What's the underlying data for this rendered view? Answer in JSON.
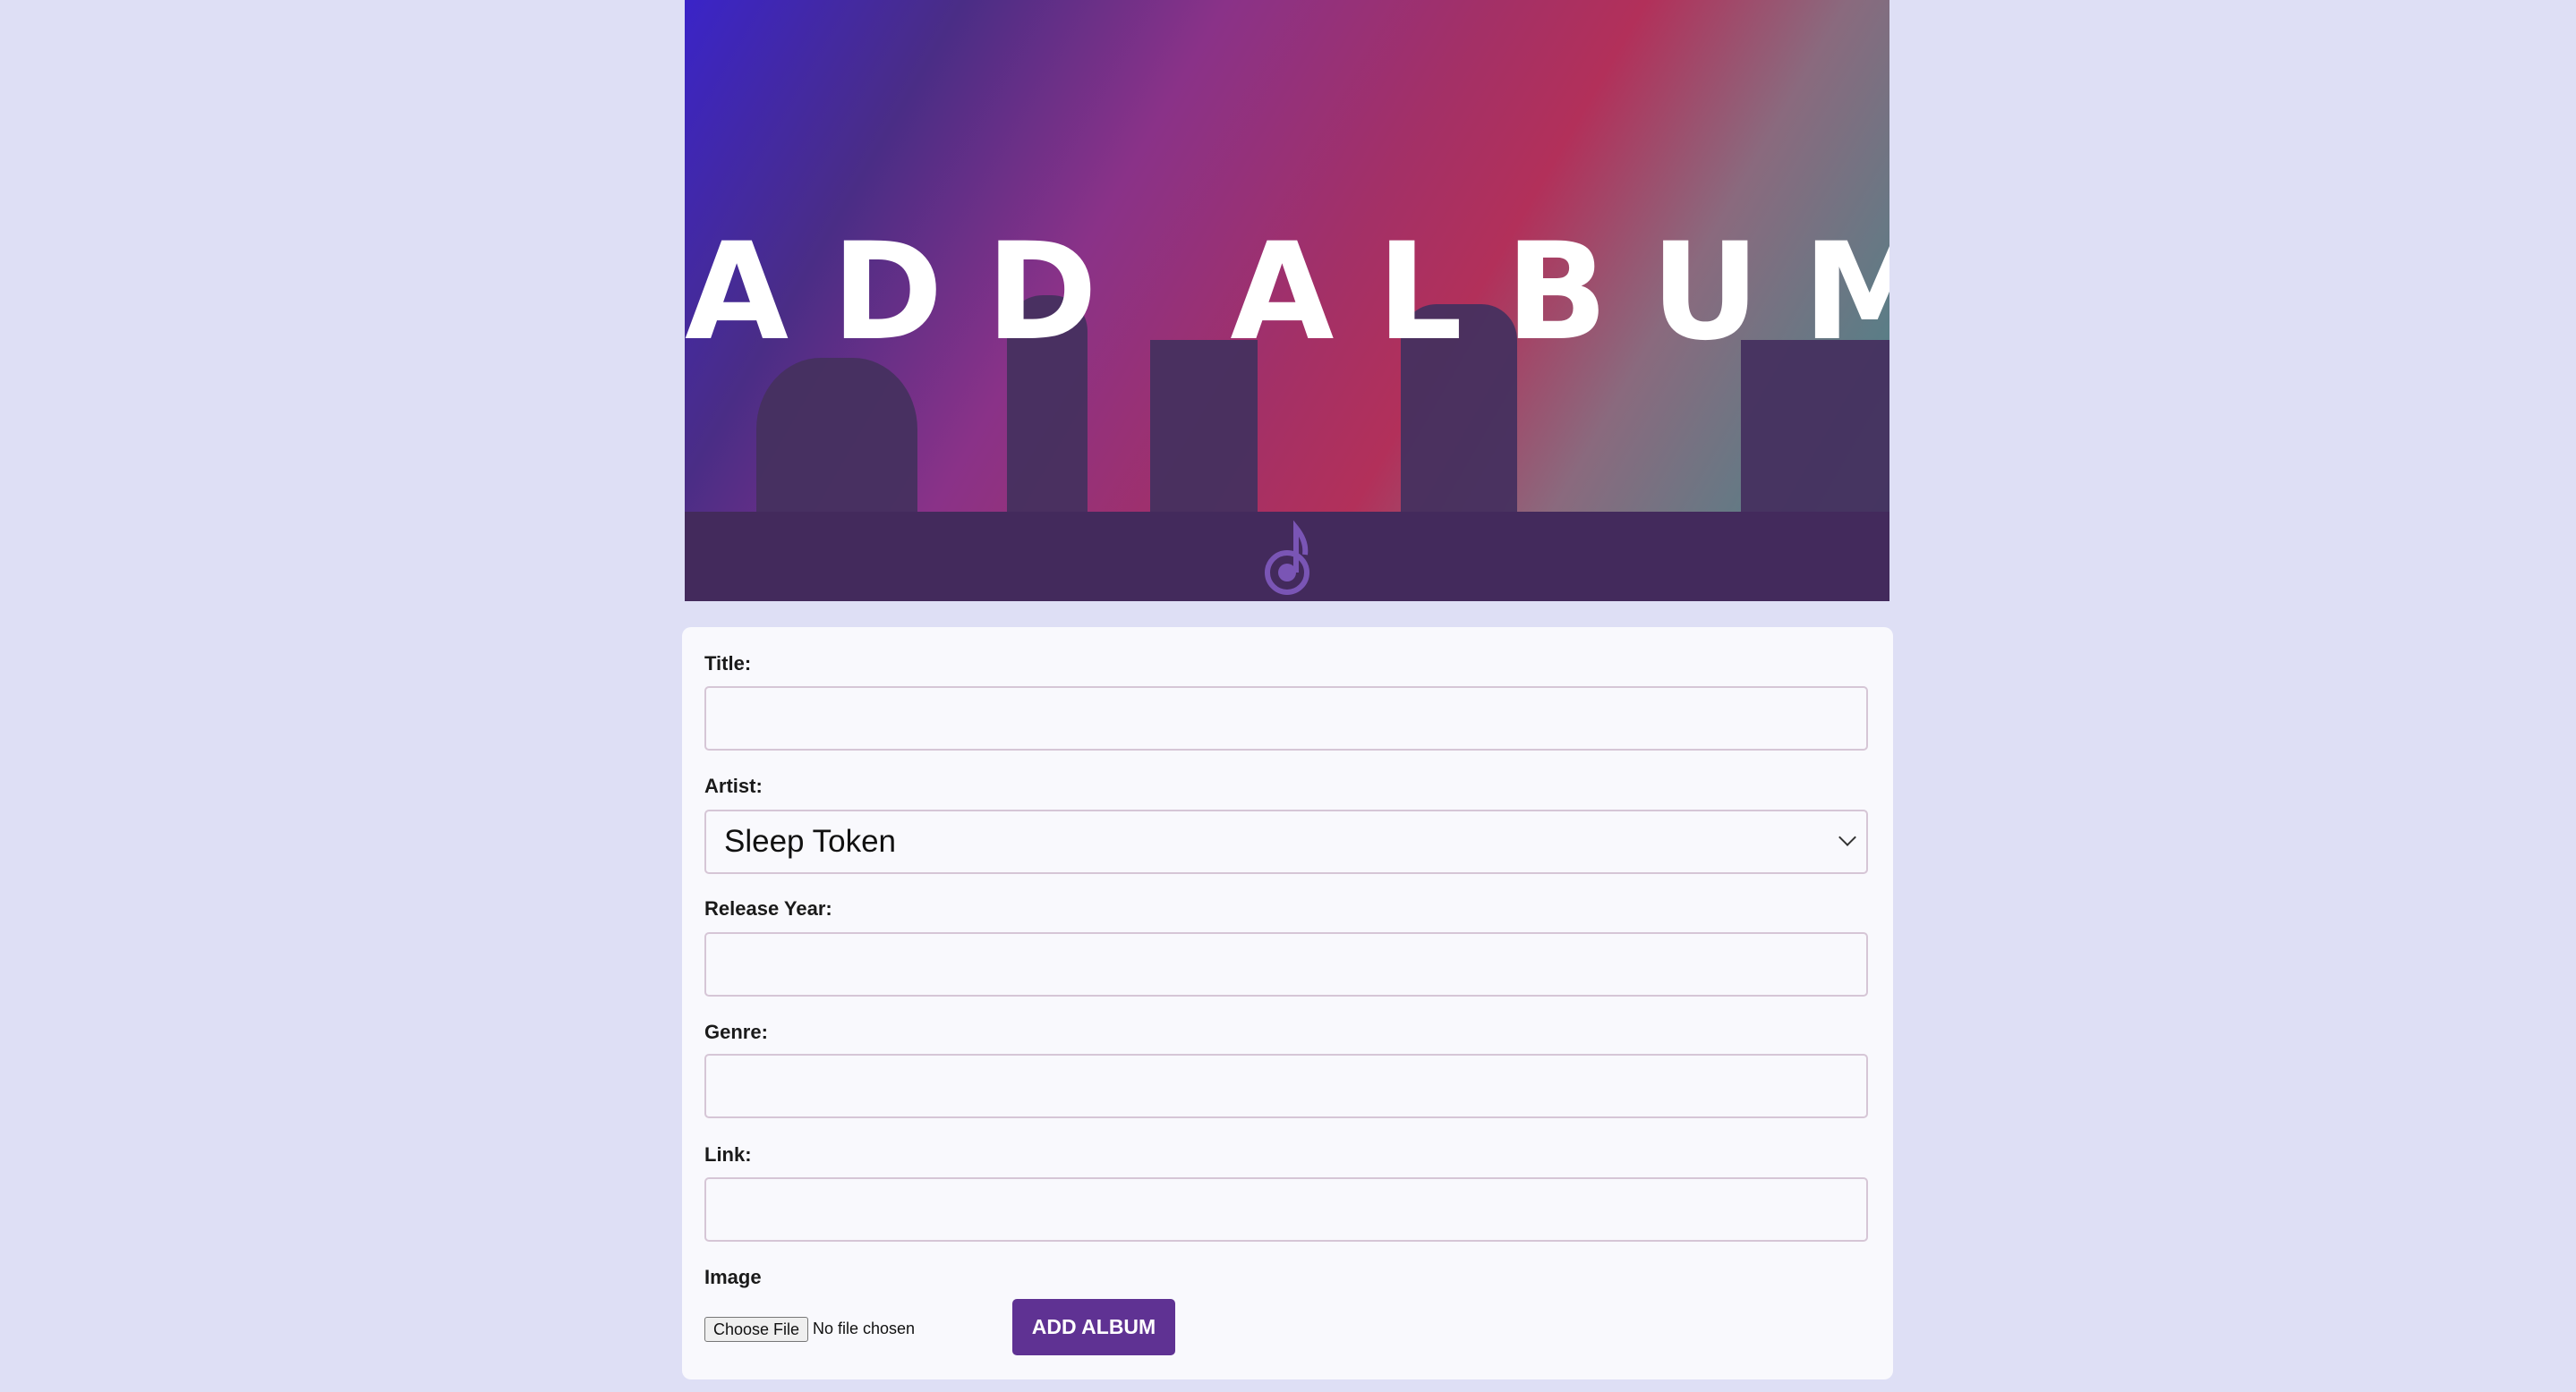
{
  "banner": {
    "title": "ADD ALBUM",
    "logo": "music-note-icon"
  },
  "form": {
    "title_label": "Title:",
    "title_value": "",
    "artist_label": "Artist:",
    "artist_value": "Sleep Token",
    "year_label": "Release Year:",
    "year_value": "",
    "genre_label": "Genre:",
    "genre_value": "",
    "link_label": "Link:",
    "link_value": "",
    "image_label": "Image",
    "choose_file": "Choose File",
    "file_status": "No file chosen",
    "submit": "ADD ALBUM"
  },
  "colors": {
    "accent": "#5f3293",
    "background": "#dedff5"
  }
}
